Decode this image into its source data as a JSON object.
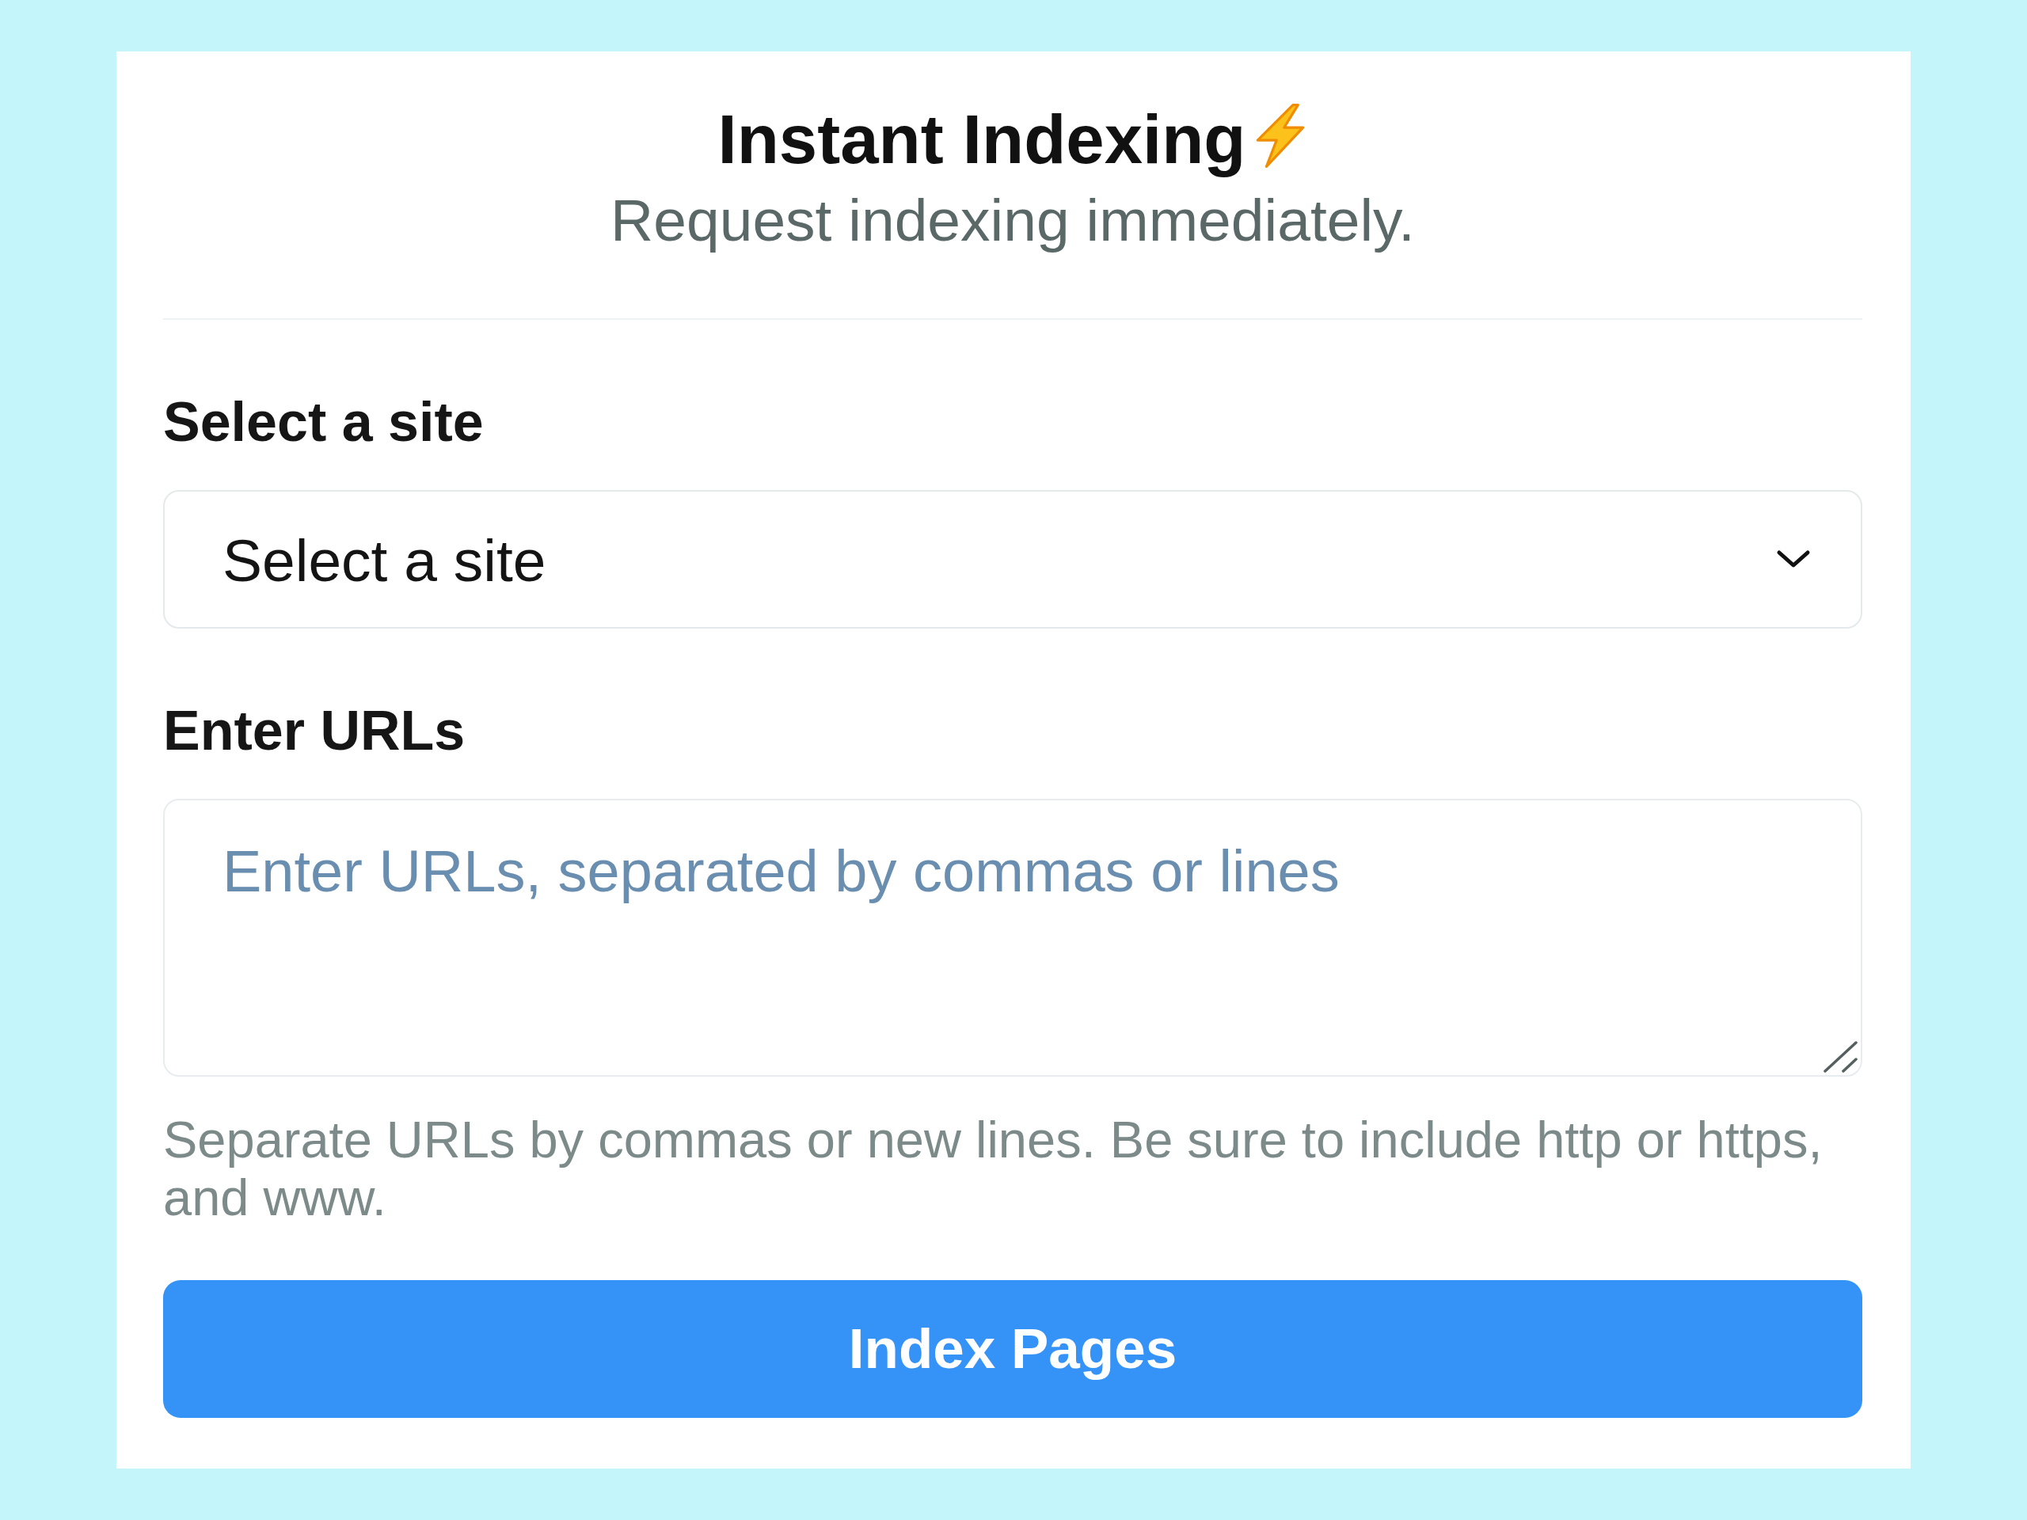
{
  "header": {
    "title": "Instant Indexing",
    "subtitle": "Request indexing immediately."
  },
  "site_field": {
    "label": "Select a site",
    "value": "Select a site"
  },
  "urls_field": {
    "label": "Enter URLs",
    "placeholder": "Enter URLs, separated by commas or lines",
    "help": "Separate URLs by commas or new lines. Be sure to include http or https, and www."
  },
  "submit_button": {
    "label": "Index Pages"
  }
}
